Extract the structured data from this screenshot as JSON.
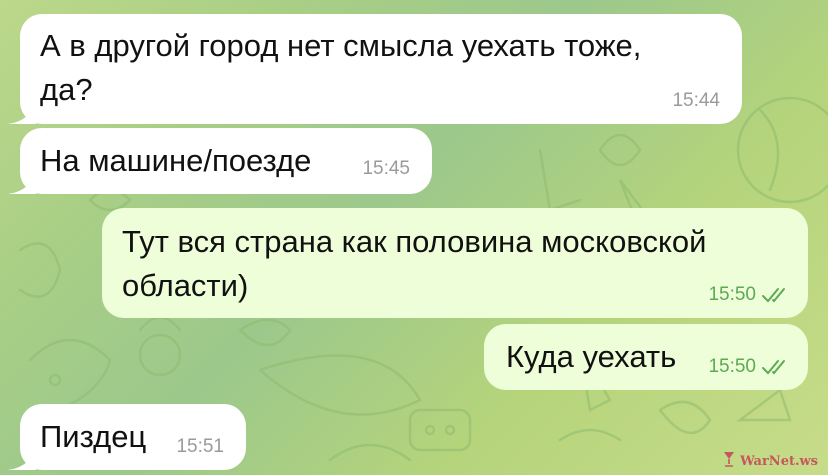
{
  "chat": {
    "messages": [
      {
        "text": "А в другой город нет смысла уехать тоже,\nда?",
        "time": "15:44",
        "direction": "incoming"
      },
      {
        "text": "На машине/поезде",
        "time": "15:45",
        "direction": "incoming"
      },
      {
        "text": "Тут вся страна как половина московской\nобласти)",
        "time": "15:50",
        "direction": "outgoing",
        "status_icon": "double-check-icon"
      },
      {
        "text": "Куда уехать",
        "time": "15:50",
        "direction": "outgoing",
        "status_icon": "double-check-icon"
      },
      {
        "text": "Пиздец",
        "time": "15:51",
        "direction": "incoming"
      }
    ]
  },
  "watermark": {
    "text": "WarNet.ws",
    "icon": "wine-glass-icon"
  },
  "colors": {
    "incoming_bubble": "#ffffff",
    "outgoing_bubble": "#eefed9",
    "incoming_time": "#9a9a9a",
    "outgoing_time": "#5daa54",
    "background": "#a9cf86"
  }
}
